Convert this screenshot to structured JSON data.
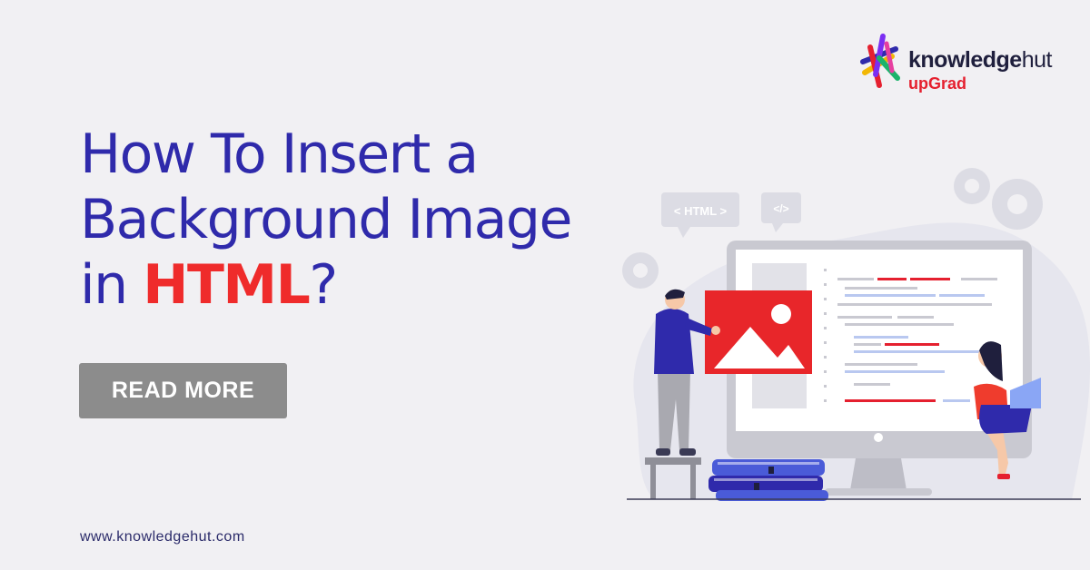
{
  "brand": {
    "name_part1": "knowledge",
    "name_part2": "hut",
    "sub": "upGrad"
  },
  "headline": {
    "line1": "How To Insert a",
    "line2": "Background Image",
    "line3_prefix": "in ",
    "line3_highlight": "HTML",
    "line3_suffix": "?"
  },
  "cta": {
    "label": "READ MORE"
  },
  "footer": {
    "url": "www.knowledgehut.com"
  },
  "illustration": {
    "html_tag": "< HTML >",
    "code_tag": "</>"
  },
  "colors": {
    "background": "#f1f0f3",
    "headline": "#2f2aab",
    "highlight": "#ef2b2b",
    "button": "#8c8c8c"
  }
}
